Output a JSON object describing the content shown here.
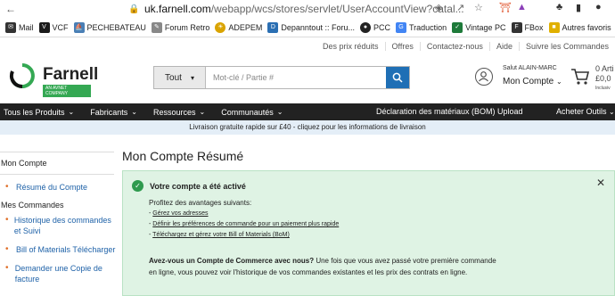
{
  "browser": {
    "url_domain": "uk.farnell.com",
    "url_path": "/webapp/wcs/stores/servlet/UserAccountView?catal...",
    "bookmarks": [
      {
        "label": "Mail",
        "color": "#333333"
      },
      {
        "label": "VCF",
        "color": "#1a1a1a"
      },
      {
        "label": "PECHEBATEAU",
        "color": "#4a7fb5"
      },
      {
        "label": "Forum Retro",
        "color": "#888888"
      },
      {
        "label": "ADEPEM",
        "color": "#d9a300"
      },
      {
        "label": "Depanntout :: Foru...",
        "color": "#2b6fb3"
      },
      {
        "label": "PCC",
        "color": "#222222"
      },
      {
        "label": "Traduction",
        "color": "#4285f4"
      },
      {
        "label": "Vintage PC",
        "color": "#1e7a3a"
      },
      {
        "label": "FBox",
        "color": "#333333"
      },
      {
        "label": "Autres favoris",
        "color": "#e0b000"
      }
    ]
  },
  "util_links": [
    "Des prix réduits",
    "Offres",
    "Contactez-nous",
    "Aide",
    "Suivre les Commandes"
  ],
  "header": {
    "logo_text": "Farnell",
    "logo_tag": "AN AVNET COMPANY",
    "search_scope": "Tout",
    "search_placeholder": "Mot-clé / Partie #",
    "greeting": "Salut ALAIN-MARC",
    "account_label": "Mon Compte",
    "cart_line1": "0 Arti",
    "cart_line2": "£0,0",
    "cart_line3": "Inclusiv"
  },
  "nav": {
    "items": [
      "Tous les Produits",
      "Fabricants",
      "Ressources",
      "Communautés"
    ],
    "bom": "Déclaration des matériaux (BOM) Upload",
    "tools": "Acheter Outils"
  },
  "promo": "Livraison gratuite rapide sur £40 - cliquez pour les informations de livraison",
  "sidebar": {
    "heading": "Mon Compte",
    "summary": "Résumé du Compte",
    "section": "Mes Commandes",
    "items": [
      "Historique des commandes et Suivi",
      "Bill of Materials Télécharger",
      "Demander une Copie de facture"
    ]
  },
  "content": {
    "title": "Mon Compte Résumé",
    "alert_title": "Votre compte a été activé",
    "alert_intro": "Profitez des avantages suivants:",
    "alert_links": [
      "Gérez vos adresses",
      "Définir les préférences de commande pour un paiement plus rapide",
      "Téléchargez et gérez votre Bill of Materials (BoM)"
    ],
    "alert_para_bold": "Avez-vous un Compte de Commerce avec nous?",
    "alert_para": " Une fois que vous avez passé votre première commande en ligne, vous pouvez voir l'historique de vos commandes existantes et les prix des contrats en ligne."
  }
}
